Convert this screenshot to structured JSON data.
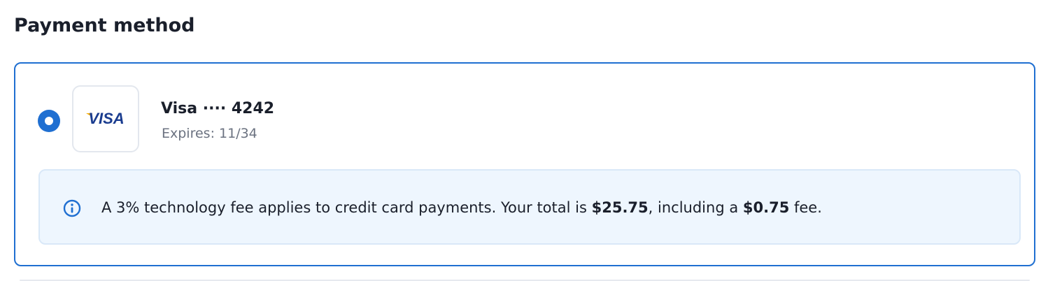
{
  "section": {
    "title": "Payment method"
  },
  "payment_option": {
    "selected": true,
    "brand_logo_text": "VISA",
    "brand_icon": "visa-card-icon",
    "card_name": "Visa ···· 4242",
    "expiry": "Expires: 11/34"
  },
  "notice": {
    "icon": "info-icon",
    "text_before_total": "A 3% technology fee applies to credit card payments. Your total is ",
    "total": "$25.75",
    "text_before_fee": ", including a ",
    "fee": "$0.75",
    "text_after_fee": " fee."
  },
  "colors": {
    "accent": "#1f6fd1",
    "notice_background": "#eef6fe",
    "visa_blue": "#1a3c8f",
    "visa_gold": "#f2a900"
  }
}
